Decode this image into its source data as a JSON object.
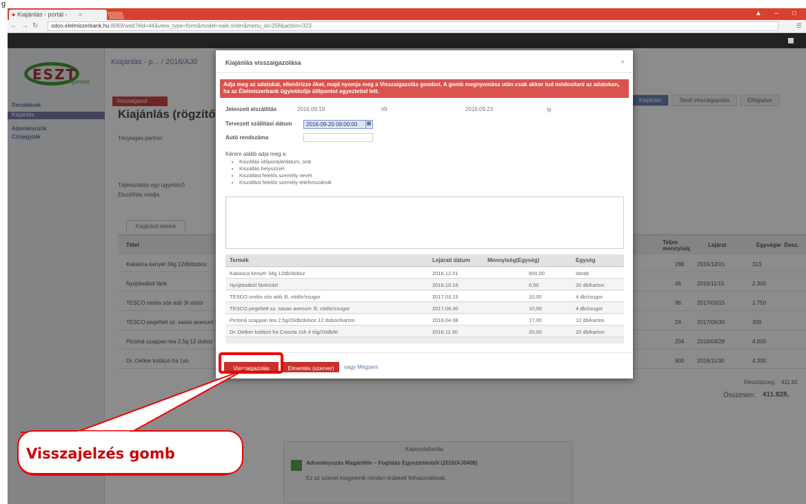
{
  "page_label": "g",
  "browser": {
    "tab_title": "Kiajánlás - portál - ",
    "url_host": "odoo.elelmiszerbank.hu",
    "url_rest": ":8069/web?#id=44&view_type=form&model=sale.order&menu_id=258&action=323"
  },
  "app": {
    "logo_text": "ESZT",
    "logo_sub": "Egyesület",
    "sidebar": [
      {
        "label": "Rendelések",
        "active": false
      },
      {
        "label": "Kiajánlás",
        "active": true
      },
      {
        "label": "Adományozók",
        "active": false
      },
      {
        "label": "Címjegyzék",
        "active": false
      }
    ],
    "breadcrumb": "Kiajánlás - p... / 2016/AJ0",
    "status_chip": "Visszaigazol",
    "page_title": "Kiajánlás (rögzítő",
    "steps": [
      "Kiajánlás",
      "Teszt visszaigazolás",
      "Elfogadva"
    ],
    "labels": {
      "partner": "Tényleges partner",
      "contact": "Tájékoztatás egy ügyintéző",
      "delivery": "Elszállítás módja"
    },
    "tab_products": "Kiajánlott tételek",
    "bg_head": {
      "item": "Tétel",
      "qty": "Teljes mennyiség",
      "date": "Lejárat",
      "unit_price": "Egységár",
      "total": "Össz."
    },
    "bg_rows": [
      {
        "item": "Kakaóca kenyér 34g 12db/doboz",
        "qty": "288",
        "date": "2016/12/01",
        "price": "313"
      },
      {
        "item": "Nyújtásából fánk",
        "qty": "46",
        "date": "2016/11/15",
        "price": "2.300"
      },
      {
        "item": "TESCO omlós sós adó 3l vödör",
        "qty": "96",
        "date": "2017/03/15",
        "price": "1.750"
      },
      {
        "item": "TESCO pegeltett sz. sasas avenum 3l vödör",
        "qty": "24",
        "date": "2017/06/30",
        "price": "300"
      },
      {
        "item": "Pictoná szappan tea 2,5g 12 doboz",
        "qty": "204",
        "date": "2016/04/28",
        "price": "4.000"
      },
      {
        "item": "Dr. Oetker kotlázó fra 1sh",
        "qty": "900",
        "date": "2016/11/30",
        "price": "4.300"
      }
    ],
    "subtotal_label": "Részösszeg:",
    "subtotal": "411.82",
    "total_label": "Összesen:",
    "total": "411.828,",
    "chatter_title": "Kapcsolattartás",
    "chatter_msg": "Adományozás Magánféle – Foglalás Egyeztetésből (2016/AJ0408)",
    "chatter_sub": "Ez az üzenet megjelenik minden érdekelt felhasználónak."
  },
  "modal": {
    "title": "Kiajánlás visszaigazolása",
    "alert": "Adja meg az adatokat, ellenőrizze őket, majd nyomja meg a Visszaigazolás gombot. A gomb megnyomása után csak akkor tud módosítani az adatokon, ha az Élelmiszerbank ügyintézője ülőpontot egyeztettel lett.",
    "fields": {
      "claimed_label": "Jelenzett elszállítás",
      "claimed_from": "2016.09.19",
      "claimed_to_label": "től",
      "claimed_to": "2016.09.23",
      "claimed_to_suffix": "ig",
      "planned_label": "Tervezett szállítási dátum",
      "planned_value": "2016-09-20 09:00:00",
      "plate_label": "Autó rendszáma"
    },
    "notes_title": "Kérem alább adja meg a:",
    "notes": [
      "Kiszállás időpontját/dátum, órát",
      "Kiszállás helyszínét",
      "Kiszállást felelős személy nevét",
      "Kiszállást felelős személy telefonszámát"
    ],
    "grid_head": {
      "item": "Termék",
      "date": "Lejárati dátum",
      "qty": "Mennyiség(Egység)",
      "unit": "Egység"
    },
    "grid_rows": [
      {
        "item": "Kakaóca kenyér 34g 12db/doboz",
        "date": "2016.12.01",
        "qty": "600,00",
        "unit": "darab"
      },
      {
        "item": "Nyújtásából fánk/zárt",
        "date": "2016.10.15",
        "qty": "6,00",
        "unit": "20 db/karton"
      },
      {
        "item": "TESCO omlós sós adó 3l, vödör/zsugor",
        "date": "2017.03.15",
        "qty": "10,00",
        "unit": "4 db/zsugor"
      },
      {
        "item": "TESCO pegeltett sz. sasas avenum 3l, vödör/zsugor",
        "date": "2017.06.30",
        "qty": "10,00",
        "unit": "4 db/zsugor"
      },
      {
        "item": "Pictoná szappan tea 2,5g/20db/doboz 12 doboz/karton",
        "date": "2016.04.08",
        "qty": "17,00",
        "unit": "12 db/karton"
      },
      {
        "item": "Dr. Oetker kotlázó fra Csiszta 1sh 4 tűg/20db/kt",
        "date": "2016.11.30",
        "qty": "20,00",
        "unit": "20 db/karton"
      }
    ],
    "btn_confirm": "Visszaigazolás",
    "btn_save": "Elmentés (szerver)",
    "or_text": "vagy",
    "cancel_link": "Mégsem"
  },
  "callout": {
    "text": "Visszajelzés gomb"
  },
  "colors": {
    "brand_red": "#d9534f",
    "chrome_red": "#d8412f",
    "highlight": "#e00000"
  }
}
